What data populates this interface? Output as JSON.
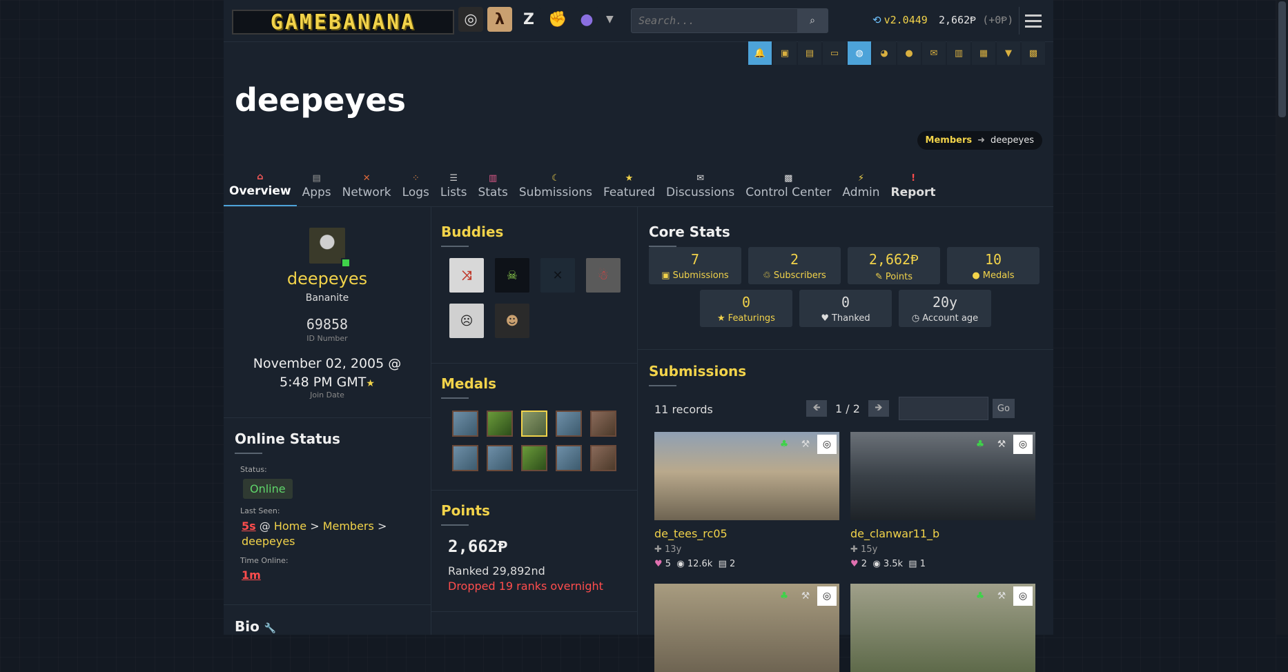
{
  "header": {
    "logo_text": "GAMEBANANA",
    "search_placeholder": "Search...",
    "version": "v2.0449",
    "points": "2,662Ᵽ",
    "points_delta": "(+0Ᵽ)"
  },
  "game_icons": [
    {
      "icon": "counter-strike-icon",
      "glyph": "◎",
      "bg": "#2a2a2a",
      "fg": "#ddd"
    },
    {
      "icon": "half-life-icon",
      "glyph": "λ",
      "bg": "#c9a070",
      "fg": "#3a1a0a"
    },
    {
      "icon": "z-game-icon",
      "glyph": "Z",
      "bg": "#1a222d",
      "fg": "#e8e8e8"
    },
    {
      "icon": "brawler-icon",
      "glyph": "✊",
      "bg": "#1a222d",
      "fg": "#e0b090"
    },
    {
      "icon": "sphere-icon",
      "glyph": "●",
      "bg": "#1a222d",
      "fg": "#8a6fe0"
    }
  ],
  "subbar_icons": [
    {
      "icon": "bell-icon",
      "glyph": "🔔",
      "on": true
    },
    {
      "icon": "avatar-icon",
      "glyph": "▣",
      "on": false
    },
    {
      "icon": "gift-icon",
      "glyph": "▤",
      "on": false
    },
    {
      "icon": "inbox-icon",
      "glyph": "▭",
      "on": false
    },
    {
      "icon": "globe-icon",
      "glyph": "◍",
      "on": true
    },
    {
      "icon": "palette-icon",
      "glyph": "◕",
      "on": false
    },
    {
      "icon": "bulb-icon",
      "glyph": "●",
      "on": false
    },
    {
      "icon": "mail-icon",
      "glyph": "✉",
      "on": false
    },
    {
      "icon": "chart-icon",
      "glyph": "▥",
      "on": false
    },
    {
      "icon": "clipboard-icon",
      "glyph": "▦",
      "on": false
    },
    {
      "icon": "download-icon",
      "glyph": "▼",
      "on": false
    },
    {
      "icon": "grid-icon",
      "glyph": "▩",
      "on": false
    }
  ],
  "page": {
    "title": "deepeyes"
  },
  "breadcrumb": {
    "parent": "Members",
    "current": "deepeyes"
  },
  "tabs": [
    {
      "label": "Overview",
      "icon": "home-icon",
      "glyph": "⌂",
      "color": "#ff5a5a",
      "active": true
    },
    {
      "label": "Apps",
      "icon": "apps-icon",
      "glyph": "▤",
      "color": "#999"
    },
    {
      "label": "Network",
      "icon": "network-icon",
      "glyph": "✕",
      "color": "#e06a3a"
    },
    {
      "label": "Logs",
      "icon": "logs-icon",
      "glyph": "⁘",
      "color": "#e08a4a"
    },
    {
      "label": "Lists",
      "icon": "lists-icon",
      "glyph": "☰",
      "color": "#ccc"
    },
    {
      "label": "Stats",
      "icon": "stats-icon",
      "glyph": "▥",
      "color": "#e05a8a"
    },
    {
      "label": "Submissions",
      "icon": "moon-icon",
      "glyph": "☾",
      "color": "#f2d34a"
    },
    {
      "label": "Featured",
      "icon": "star-icon",
      "glyph": "★",
      "color": "#f2d34a"
    },
    {
      "label": "Discussions",
      "icon": "chat-icon",
      "glyph": "✉",
      "color": "#ddd"
    },
    {
      "label": "Control Center",
      "icon": "control-icon",
      "glyph": "▩",
      "color": "#ddd"
    },
    {
      "label": "Admin",
      "icon": "bolt-icon",
      "glyph": "⚡",
      "color": "#f2d34a"
    },
    {
      "label": "Report",
      "icon": "alert-icon",
      "glyph": "!",
      "color": "#ff4d4d",
      "report": true
    }
  ],
  "profile": {
    "name": "deepeyes",
    "role": "Bananite",
    "id_number": "69858",
    "id_label": "ID Number",
    "join_date": "November 02, 2005 @ 5:48 PM GMT",
    "join_label": "Join Date"
  },
  "online": {
    "heading": "Online Status",
    "status_label": "Status:",
    "status": "Online",
    "last_seen_label": "Last Seen:",
    "last_seen_time": "5s",
    "at": "@",
    "loc_home": "Home",
    "gt": ">",
    "loc_members": "Members",
    "loc_user": "deepeyes",
    "time_online_label": "Time Online:",
    "time_online": "1m"
  },
  "bio": {
    "heading": "Bio"
  },
  "buddies": {
    "heading": "Buddies",
    "items": [
      {
        "glyph": "⤨",
        "bg": "#d8d8d8",
        "fg": "#c0392b"
      },
      {
        "glyph": "☠",
        "bg": "#0e1218",
        "fg": "#8fd14f"
      },
      {
        "glyph": "✕",
        "bg": "#1e2a36",
        "fg": "#0e1218"
      },
      {
        "glyph": "☃",
        "bg": "#5a5a5a",
        "fg": "#e84040"
      },
      {
        "glyph": "☹",
        "bg": "#d0d0d0",
        "fg": "#222"
      },
      {
        "glyph": "☻",
        "bg": "#2a2a2a",
        "fg": "#c9a070"
      }
    ]
  },
  "medals": {
    "heading": "Medals",
    "count": 10
  },
  "points_box": {
    "heading": "Points",
    "value": "2,662Ᵽ",
    "rank": "Ranked 29,892nd",
    "change": "Dropped 19 ranks overnight"
  },
  "core_stats": {
    "heading": "Core Stats",
    "items": [
      {
        "value": "7",
        "label": "Submissions",
        "icon": "submissions-icon",
        "glyph": "▣"
      },
      {
        "value": "2",
        "label": "Subscribers",
        "icon": "subscribers-icon",
        "glyph": "♲"
      },
      {
        "value": "2,662Ᵽ",
        "label": "Points",
        "icon": "points-icon",
        "glyph": "✎"
      },
      {
        "value": "10",
        "label": "Medals",
        "icon": "medal-icon",
        "glyph": "●"
      },
      {
        "value": "0",
        "label": "Featurings",
        "icon": "featuring-icon",
        "glyph": "★"
      },
      {
        "value": "0",
        "label": "Thanked",
        "icon": "thanked-icon",
        "glyph": "♥",
        "gray": true
      },
      {
        "value": "20y",
        "label": "Account age",
        "icon": "clock-icon",
        "glyph": "◷",
        "gray": true
      }
    ]
  },
  "submissions": {
    "heading": "Submissions",
    "records": "11 records",
    "page": "1 / 2",
    "go_label": "Go",
    "cards": [
      {
        "name": "de_tees_rc05",
        "age": "13y",
        "likes": "5",
        "views": "12.6k",
        "posts": "2",
        "game": "counter-strike-icon"
      },
      {
        "name": "de_clanwar11_b",
        "age": "15y",
        "likes": "2",
        "views": "3.5k",
        "posts": "1",
        "game": "counter-strike-icon"
      },
      {
        "name": "",
        "age": "",
        "likes": "",
        "views": "",
        "posts": ""
      },
      {
        "name": "",
        "age": "",
        "likes": "",
        "views": "",
        "posts": ""
      }
    ]
  }
}
